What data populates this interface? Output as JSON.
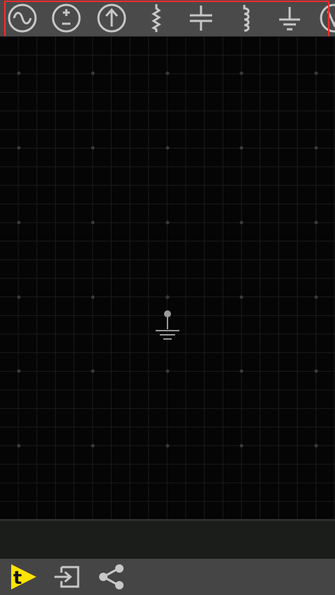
{
  "toolbar": {
    "items": [
      {
        "name": "ac-source-icon"
      },
      {
        "name": "dc-voltage-source-icon"
      },
      {
        "name": "current-source-icon"
      },
      {
        "name": "resistor-icon"
      },
      {
        "name": "capacitor-icon"
      },
      {
        "name": "inductor-icon"
      },
      {
        "name": "ground-icon"
      },
      {
        "name": "voltmeter-icon"
      }
    ],
    "highlight_color": "#ff2a2a"
  },
  "canvas": {
    "grid_color": "#1b1b1b",
    "dot_color": "#3a3a3a",
    "component": "ground-icon"
  },
  "bottom_bar": {
    "buttons": [
      {
        "name": "app-logo-button",
        "glyph": "t",
        "color": "#ffe400"
      },
      {
        "name": "import-export-button"
      },
      {
        "name": "share-button"
      }
    ]
  }
}
